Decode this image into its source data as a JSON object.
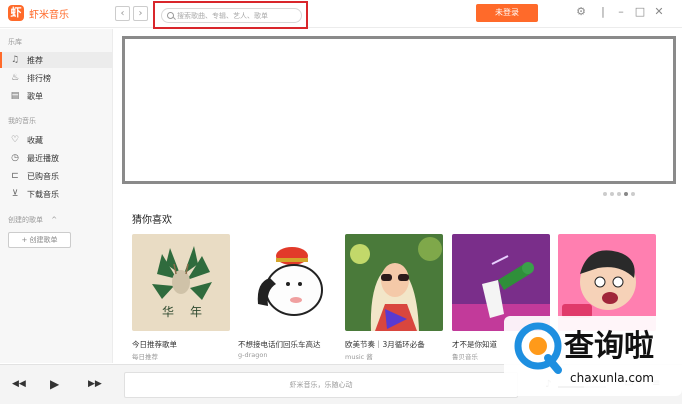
{
  "titlebar": {
    "logo_mark": "虾",
    "app_name": "虾米音乐",
    "back_glyph": "‹",
    "forward_glyph": "›",
    "search_placeholder": "搜索歌曲、专辑、艺人、歌单",
    "login_label": "未登录"
  },
  "sidebar": {
    "library_heading": "乐库",
    "library_items": [
      {
        "label": "推荐",
        "icon": "music-note-icon",
        "glyph": "♫",
        "active": true
      },
      {
        "label": "排行榜",
        "icon": "thumbs-up-icon",
        "glyph": "♨",
        "active": false
      },
      {
        "label": "歌单",
        "icon": "playlist-icon",
        "glyph": "▤",
        "active": false
      }
    ],
    "my_music_heading": "我的音乐",
    "my_music_items": [
      {
        "label": "收藏",
        "icon": "heart-icon",
        "glyph": "♡"
      },
      {
        "label": "最近播放",
        "icon": "clock-icon",
        "glyph": "◷"
      },
      {
        "label": "已购音乐",
        "icon": "cart-icon",
        "glyph": "⊏"
      },
      {
        "label": "下载音乐",
        "icon": "download-icon",
        "glyph": "⊻"
      }
    ],
    "created_heading": "创建的歌单",
    "created_toggle": "^",
    "create_button": "+ 创建歌单"
  },
  "main": {
    "section_title": "猜你喜欢",
    "carousel_dot_count": 5,
    "carousel_active_dot": 4,
    "cards": [
      {
        "title": "今日推荐歌单",
        "subtitle": "每日推荐"
      },
      {
        "title": "不想接电话们回乐车高达",
        "subtitle": "g-dragon"
      },
      {
        "title": "欧美节奏｜3月循环必备",
        "subtitle": "music 酱"
      },
      {
        "title": "才不是你知道",
        "subtitle": "鲁贝音乐"
      },
      {
        "title": "",
        "subtitle": ""
      }
    ]
  },
  "player": {
    "prev_glyph": "◀◀",
    "play_glyph": "▶",
    "next_glyph": "▶▶",
    "now_playing_text": "虾米音乐，乐随心动",
    "volume_level": 0.55
  },
  "watermark": {
    "brand_cn": "查询啦",
    "brand_url": "chaxunla.com"
  },
  "colors": {
    "accent": "#ff6a2a",
    "highlight_box": "#d9262b"
  }
}
